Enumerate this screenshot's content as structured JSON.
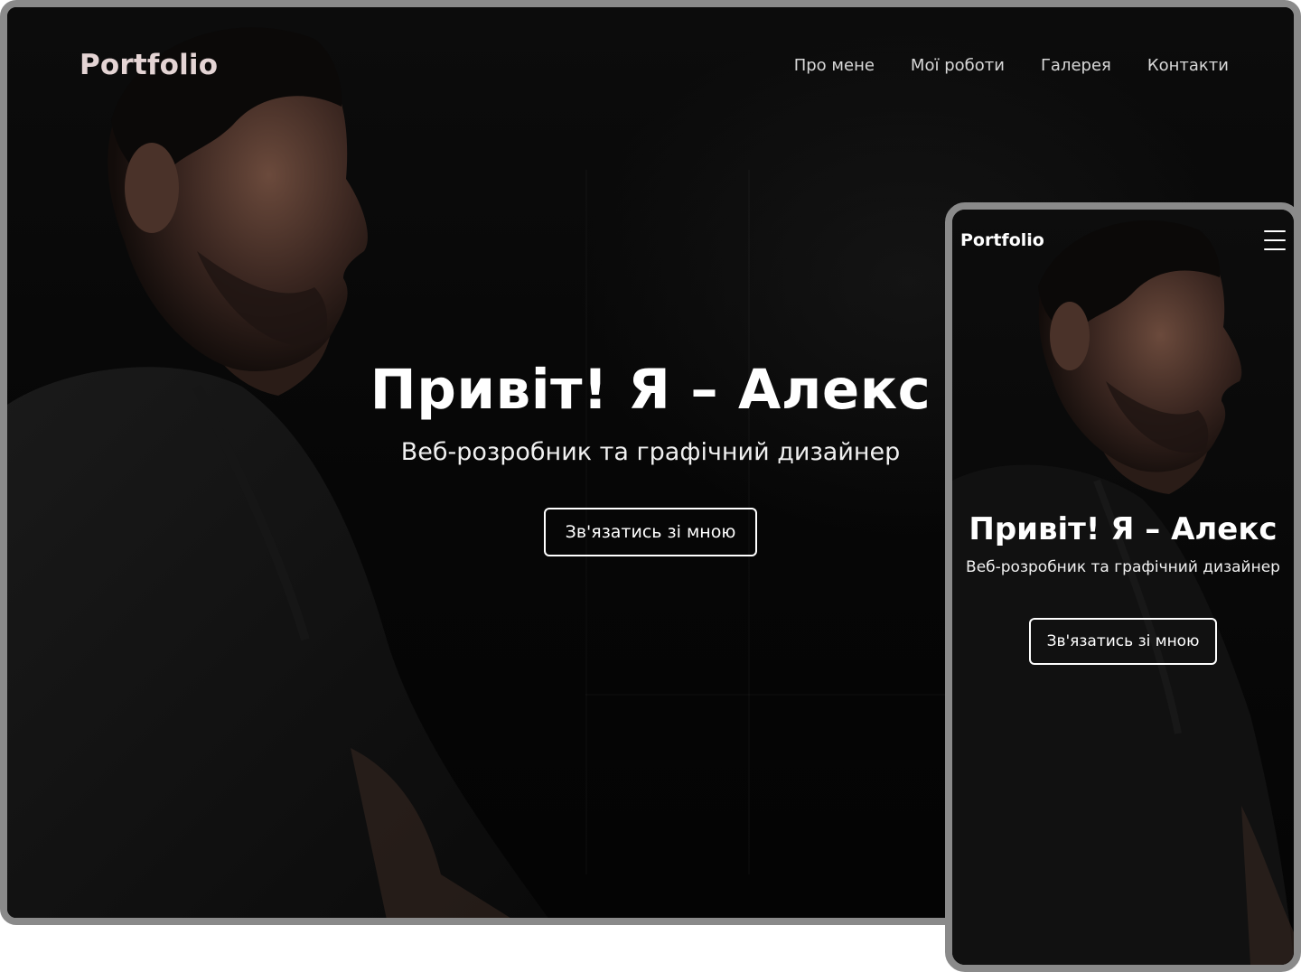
{
  "colors": {
    "background": "#050505",
    "logo": "#e4d4d4",
    "text": "#ffffff",
    "frame": "#8a8a8a"
  },
  "desktop": {
    "logo": "Portfolio",
    "nav": [
      {
        "label": "Про мене"
      },
      {
        "label": "Мої роботи"
      },
      {
        "label": "Галерея"
      },
      {
        "label": "Контакти"
      }
    ],
    "hero": {
      "title": "Привіт! Я – Алекс",
      "subtitle": "Веб-розробник та графічний дизайнер",
      "cta": "Зв'язатись зі мною"
    },
    "background_image": "man-profile-photo"
  },
  "mobile": {
    "logo": "Portfolio",
    "menu_icon": "hamburger-icon",
    "hero": {
      "title": "Привіт! Я – Алекс",
      "subtitle": "Веб-розробник та графічний дизайнер",
      "cta": "Зв'язатись зі мною"
    },
    "background_image": "man-profile-photo"
  }
}
